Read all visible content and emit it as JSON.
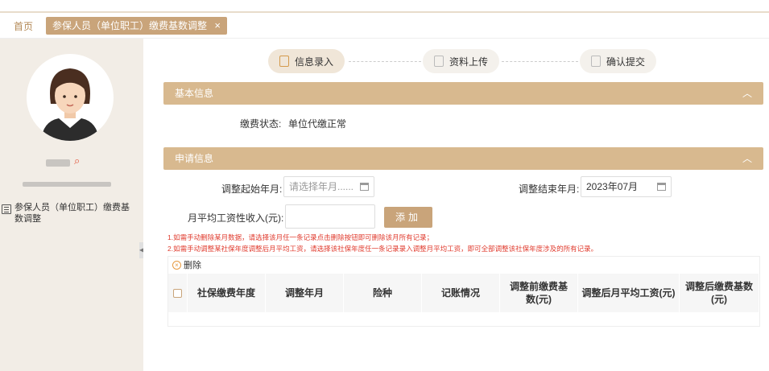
{
  "tabs": {
    "home": "首页",
    "active": "参保人员（单位职工）缴费基数调整",
    "close": "×"
  },
  "sidebar": {
    "menu_item": "参保人员（单位职工）缴费基数调整"
  },
  "steps": [
    {
      "label": "信息录入",
      "active": true
    },
    {
      "label": "资料上传",
      "active": false
    },
    {
      "label": "确认提交",
      "active": false
    }
  ],
  "basic_info": {
    "title": "基本信息",
    "status_label": "缴费状态:",
    "status_value": "单位代缴正常"
  },
  "apply_info": {
    "title": "申请信息",
    "start_label": "调整起始年月:",
    "start_placeholder": "请选择年月......",
    "end_label": "调整结束年月:",
    "end_value": "2023年07月",
    "income_label": "月平均工资性收入(元):",
    "add_button": "添加",
    "notes": [
      "1.如需手动删除某月数据，请选择该月任一条记录点击删除按钮即可删除该月所有记录；",
      "2.如需手动调整某社保年度调整后月平均工资，请选择该社保年度任一条记录录入调整月平均工资，即可全部调整该社保年度涉及的所有记录。"
    ]
  },
  "table": {
    "delete_label": "删除",
    "columns": [
      "社保缴费年度",
      "调整年月",
      "险种",
      "记账情况",
      "调整前缴费基数(元)",
      "调整后月平均工资(元)",
      "调整后缴费基数(元)"
    ]
  }
}
